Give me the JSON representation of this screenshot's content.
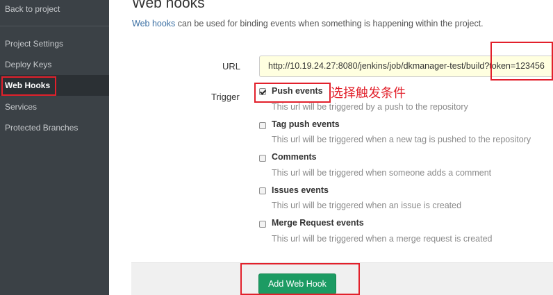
{
  "sidebar": {
    "back_label": "Back to project",
    "items": [
      {
        "label": "Project Settings"
      },
      {
        "label": "Deploy Keys"
      },
      {
        "label": "Web Hooks"
      },
      {
        "label": "Services"
      },
      {
        "label": "Protected Branches"
      }
    ]
  },
  "header": {
    "title": "Web hooks",
    "description_link": "Web hooks",
    "description_rest": " can be used for binding events when something is happening within the project."
  },
  "form": {
    "url_label": "URL",
    "url_value": "http://10.19.24.27:8080/jenkins/job/dkmanager-test/build?token=123456",
    "trigger_label": "Trigger",
    "triggers": [
      {
        "title": "Push events",
        "help": "This url will be triggered by a push to the repository",
        "checked": true
      },
      {
        "title": "Tag push events",
        "help": "This url will be triggered when a new tag is pushed to the repository",
        "checked": false
      },
      {
        "title": "Comments",
        "help": "This url will be triggered when someone adds a comment",
        "checked": false
      },
      {
        "title": "Issues events",
        "help": "This url will be triggered when an issue is created",
        "checked": false
      },
      {
        "title": "Merge Request events",
        "help": "This url will be triggered when a merge request is created",
        "checked": false
      }
    ],
    "submit_label": "Add Web Hook"
  },
  "annotation": {
    "text": "选择触发条件",
    "color": "#e2202b"
  },
  "colors": {
    "sidebar_bg": "#3b4146",
    "button_green": "#1c9b63",
    "link_blue": "#3a6fa3"
  }
}
